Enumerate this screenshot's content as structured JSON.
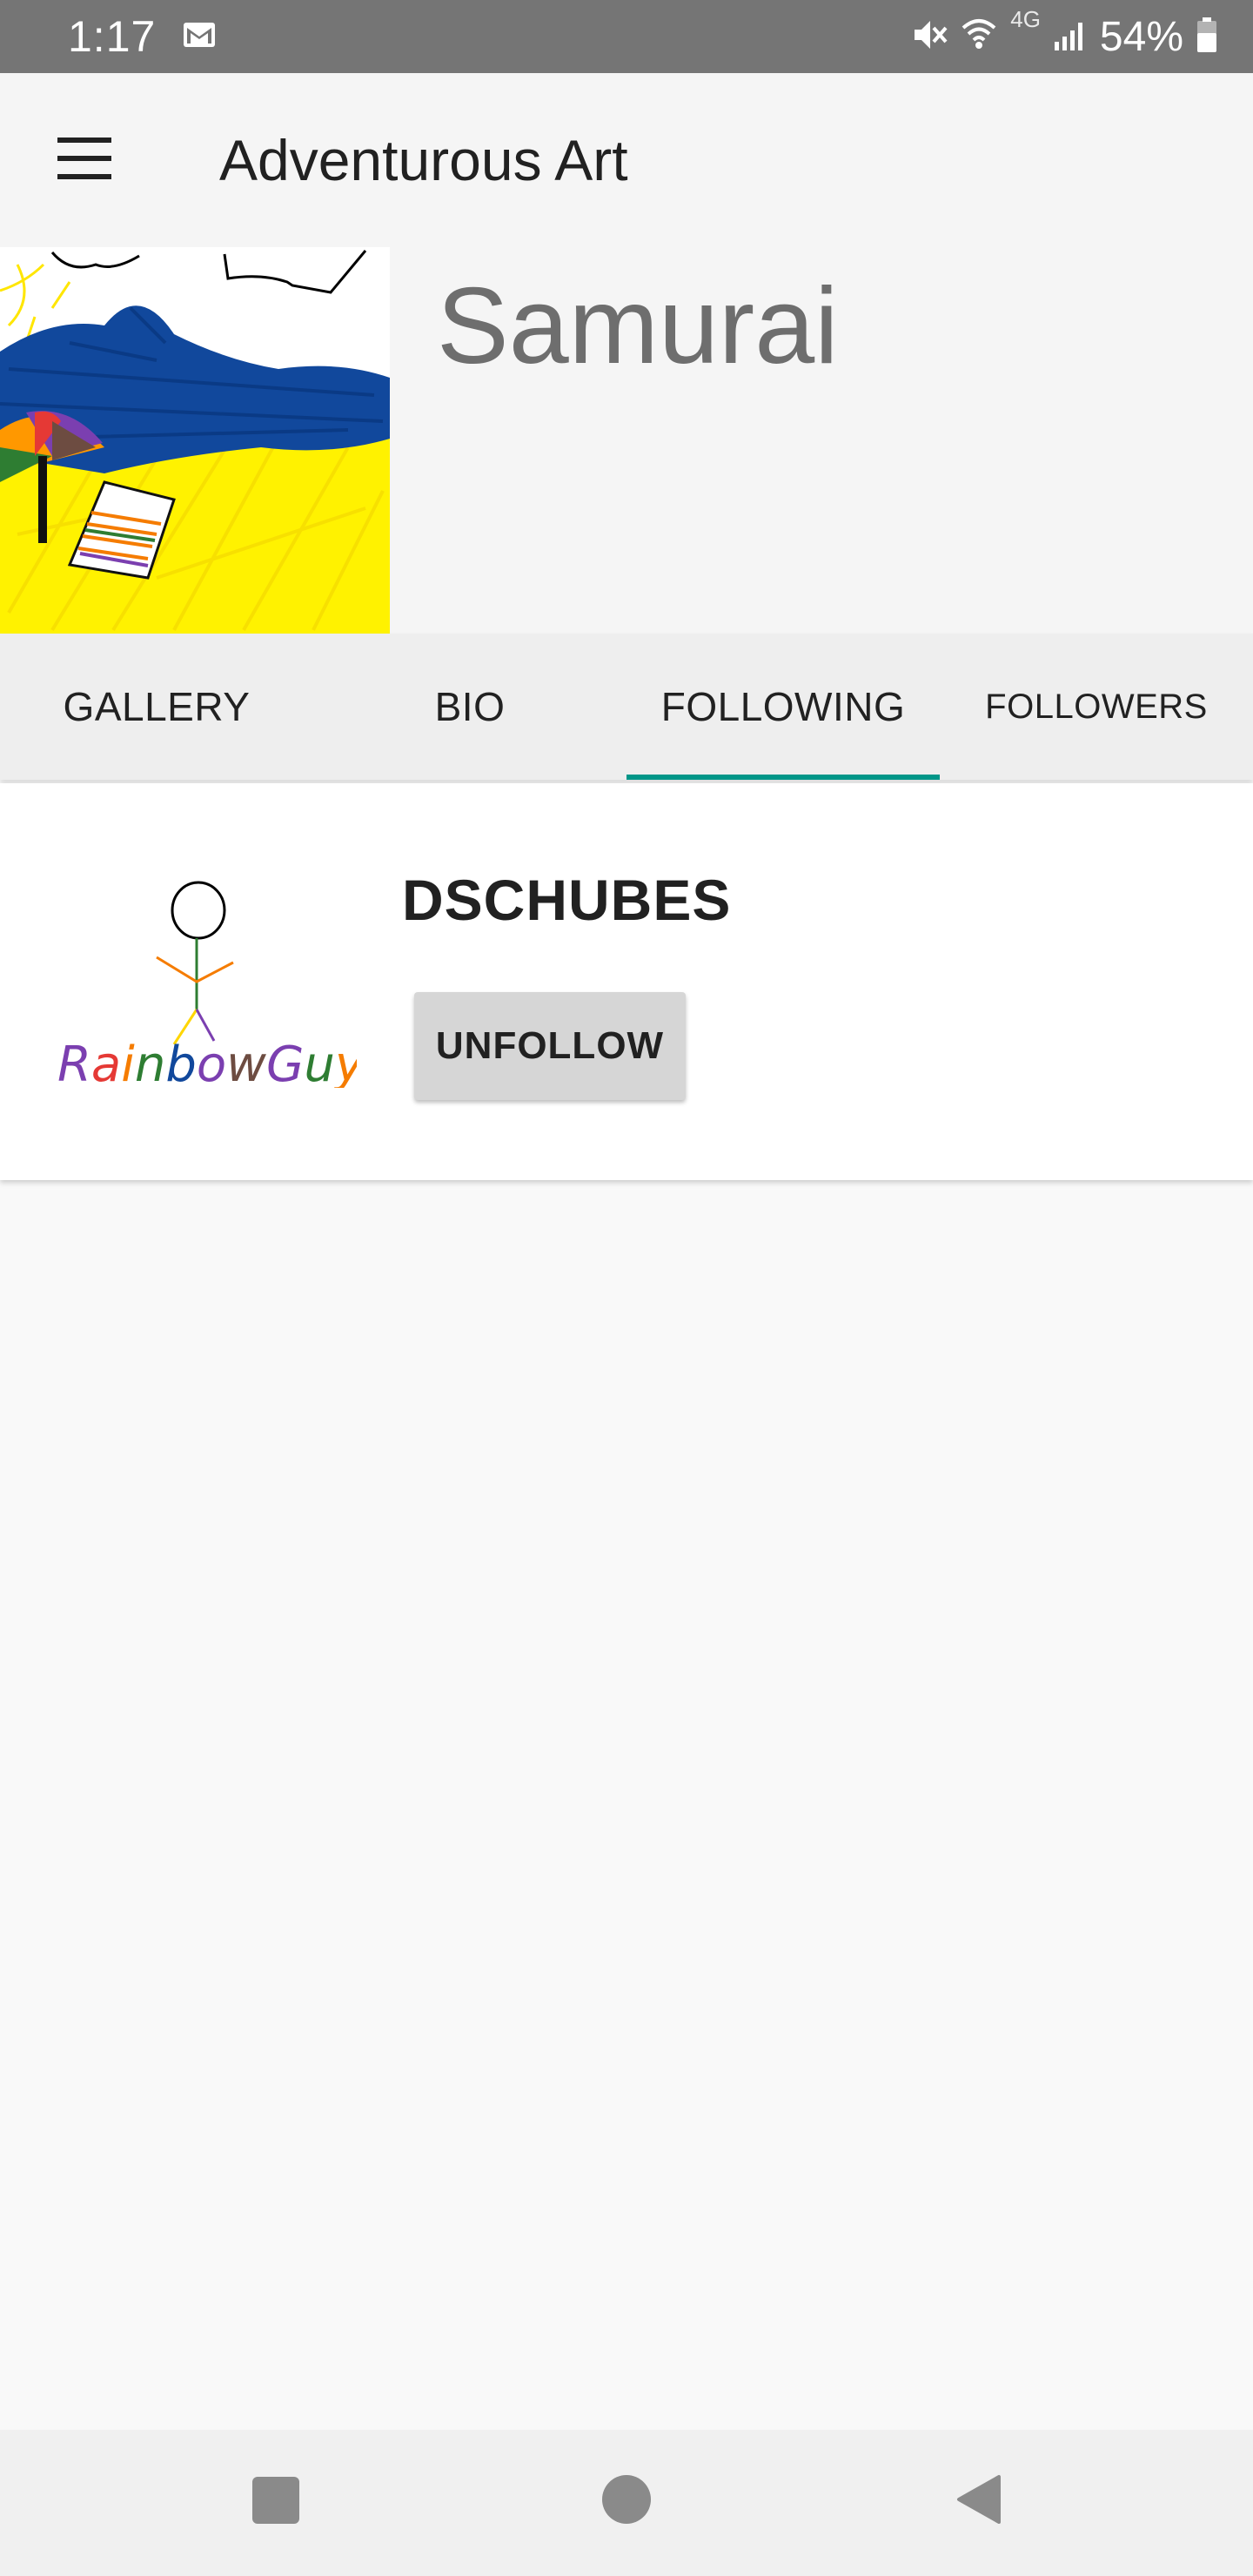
{
  "status_bar": {
    "time": "1:17",
    "network": "4G",
    "battery": "54%",
    "icons": [
      "mail-icon",
      "mute-icon",
      "wifi-icon",
      "signal-icon",
      "battery-icon"
    ]
  },
  "app_bar": {
    "title": "Adventurous Art",
    "menu_icon": "hamburger-menu-icon"
  },
  "profile": {
    "name": "Samurai"
  },
  "tabs": [
    {
      "label": "GALLERY",
      "active": false
    },
    {
      "label": "BIO",
      "active": false
    },
    {
      "label": "FOLLOWING",
      "active": true
    },
    {
      "label": "FOLLOWERS",
      "active": false
    }
  ],
  "following": [
    {
      "username": "DSCHUBES",
      "drawing_text": "RainbowGuy",
      "button_label": "UNFOLLOW"
    }
  ],
  "colors": {
    "accent": "#009688",
    "status_bar": "#757575",
    "button": "#d6d6d6"
  },
  "nav_bar": {
    "icons": [
      "recents-icon",
      "home-icon",
      "back-icon"
    ]
  }
}
